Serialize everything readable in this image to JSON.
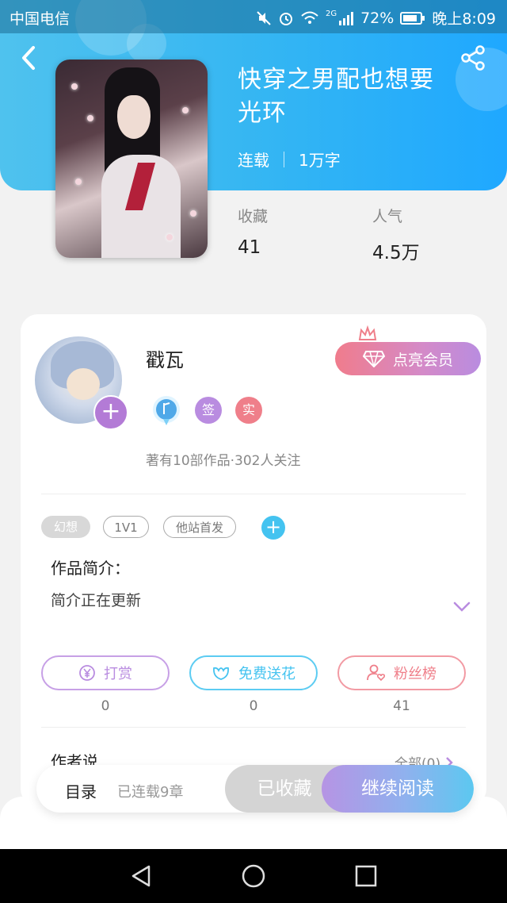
{
  "colors": {
    "header_start": "#4fc2ee",
    "header_end": "#1fa8ff",
    "accent_purple": "#b37bd6",
    "accent_blue": "#44c3f0",
    "accent_red": "#f07c8c"
  },
  "status_bar": {
    "carrier": "中国电信",
    "network": "2G",
    "battery": "72%",
    "time": "晚上8:09"
  },
  "book": {
    "title_line1": "快穿之男配也想要",
    "title_line2": "光环",
    "status": "连载",
    "words": "1万字"
  },
  "stats": [
    {
      "label": "收藏",
      "value": "41"
    },
    {
      "label": "人气",
      "value": "4.5万"
    }
  ],
  "author": {
    "name": "戳瓦",
    "vip_label": "点亮会员",
    "badges": [
      {
        "text": "签",
        "color": "#b98ce0"
      },
      {
        "text": "实",
        "color": "#ef7f8a"
      }
    ],
    "stats_text": "著有10部作品·302人关注"
  },
  "tags": [
    "幻想",
    "1V1",
    "他站首发"
  ],
  "intro": {
    "title": "作品简介：",
    "text": "简介正在更新"
  },
  "actions": [
    {
      "label": "打赏",
      "count": "0",
      "color": "#b98ce0"
    },
    {
      "label": "免费送花",
      "count": "0",
      "color": "#44c3f0"
    },
    {
      "label": "粉丝榜",
      "count": "41",
      "color": "#ef7f8a"
    }
  ],
  "author_says": {
    "title": "作者说",
    "all_label": "全部(0)"
  },
  "bottom_bar": {
    "toc_label": "目录",
    "toc_sub": "已连载9章",
    "collected_label": "已收藏",
    "continue_label": "继续阅读"
  }
}
